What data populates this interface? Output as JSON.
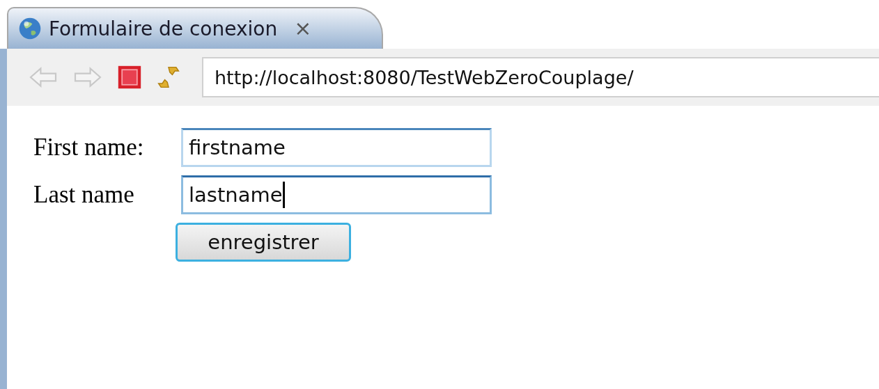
{
  "tab": {
    "title": "Formulaire de conexion",
    "close": "⨯",
    "selected": true
  },
  "address": {
    "value": "http://localhost:8080/TestWebZeroCouplage/"
  },
  "form": {
    "fields": [
      {
        "label": "First name:",
        "value": "firstname",
        "focused": false
      },
      {
        "label": "Last name",
        "value": "lastname",
        "focused": true
      }
    ],
    "button": "enregistrer"
  }
}
